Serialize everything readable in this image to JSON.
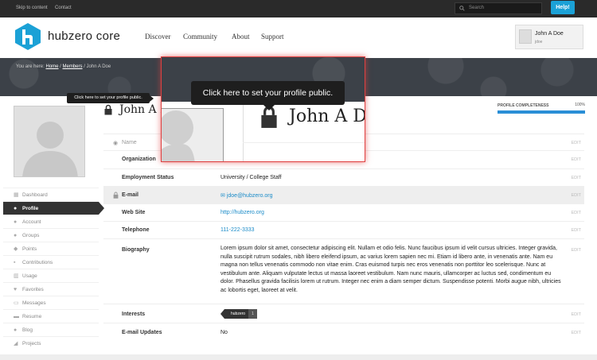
{
  "utility": {
    "skip_label": "Skip to content",
    "contact_label": "Contact",
    "search_placeholder": "Search",
    "help_label": "Help!"
  },
  "header": {
    "logo_text": "hubzero core",
    "nav": [
      "Discover",
      "Community",
      "About",
      "Support"
    ],
    "account_name": "John A Doe",
    "account_sub": "jdoe"
  },
  "breadcrumb": {
    "prefix": "You are here:",
    "home": "Home",
    "members": "Members",
    "current": "/ John A Doe"
  },
  "profile": {
    "name": "John A Doe",
    "completeness_label": "PROFILE COMPLETENESS",
    "completeness_pct": "100%",
    "completeness_value": 100
  },
  "sidebar": {
    "items": [
      {
        "label": "Dashboard",
        "icon": "dashboard-icon",
        "glyph": "▦"
      },
      {
        "label": "Profile",
        "icon": "profile-icon",
        "glyph": "●"
      },
      {
        "label": "Account",
        "icon": "account-icon",
        "glyph": "●"
      },
      {
        "label": "Groups",
        "icon": "groups-icon",
        "glyph": "●"
      },
      {
        "label": "Points",
        "icon": "points-icon",
        "glyph": "◆"
      },
      {
        "label": "Contributions",
        "icon": "contributions-icon",
        "glyph": "▪"
      },
      {
        "label": "Usage",
        "icon": "usage-icon",
        "glyph": "▥"
      },
      {
        "label": "Favorites",
        "icon": "favorites-icon",
        "glyph": "♥"
      },
      {
        "label": "Messages",
        "icon": "messages-icon",
        "glyph": "▭"
      },
      {
        "label": "Resume",
        "icon": "resume-icon",
        "glyph": "▬"
      },
      {
        "label": "Blog",
        "icon": "blog-icon",
        "glyph": "●"
      },
      {
        "label": "Projects",
        "icon": "projects-icon",
        "glyph": "◢"
      }
    ]
  },
  "fields": {
    "edit_label": "EDIT",
    "name_label": "Name",
    "organization_label": "Organization",
    "employment_label": "Employment Status",
    "employment_value": "University / College Staff",
    "email_label": "E-mail",
    "email_value": "jdoe@hubzero.org",
    "website_label": "Web Site",
    "website_value": "http://hubzero.org",
    "telephone_label": "Telephone",
    "telephone_value": "111-222-3333",
    "biography_label": "Biography",
    "biography_value": "Lorem ipsum dolor sit amet, consectetur adipiscing elit. Nullam et odio felis. Nunc faucibus ipsum id velit cursus ultricies. Integer gravida, nulla suscipit rutrum sodales, nibh libero eleifend ipsum, ac varius lorem sapien nec mi. Etiam id libero ante, in venenatis ante. Nam eu magna non tellus venenatis commodo non vitae enim. Cras euismod turpis nec eros venenatis non porttitor leo scelerisque. Nunc at vestibulum ante. Aliquam vulputate lectus ut massa laoreet vestibulum. Nam nunc mauris, ullamcorper ac luctus sed, condimentum eu dolor. Phasellus gravida facilisis lorem ut rutrum. Integer nec enim a diam semper dictum. Suspendisse potenti. Morbi augue nibh, ultricies ac lobortis eget, laoreet at velit.",
    "interests_label": "Interests",
    "interest_tag": "hubzero",
    "interest_count": "1",
    "email_updates_label": "E-mail Updates",
    "email_updates_value": "No"
  },
  "tooltip": {
    "text": "Click here to set your profile public."
  },
  "colors": {
    "accent": "#1ba1d6",
    "link": "#1a8bc8",
    "callout_border": "#e04040",
    "dark": "#333333"
  }
}
